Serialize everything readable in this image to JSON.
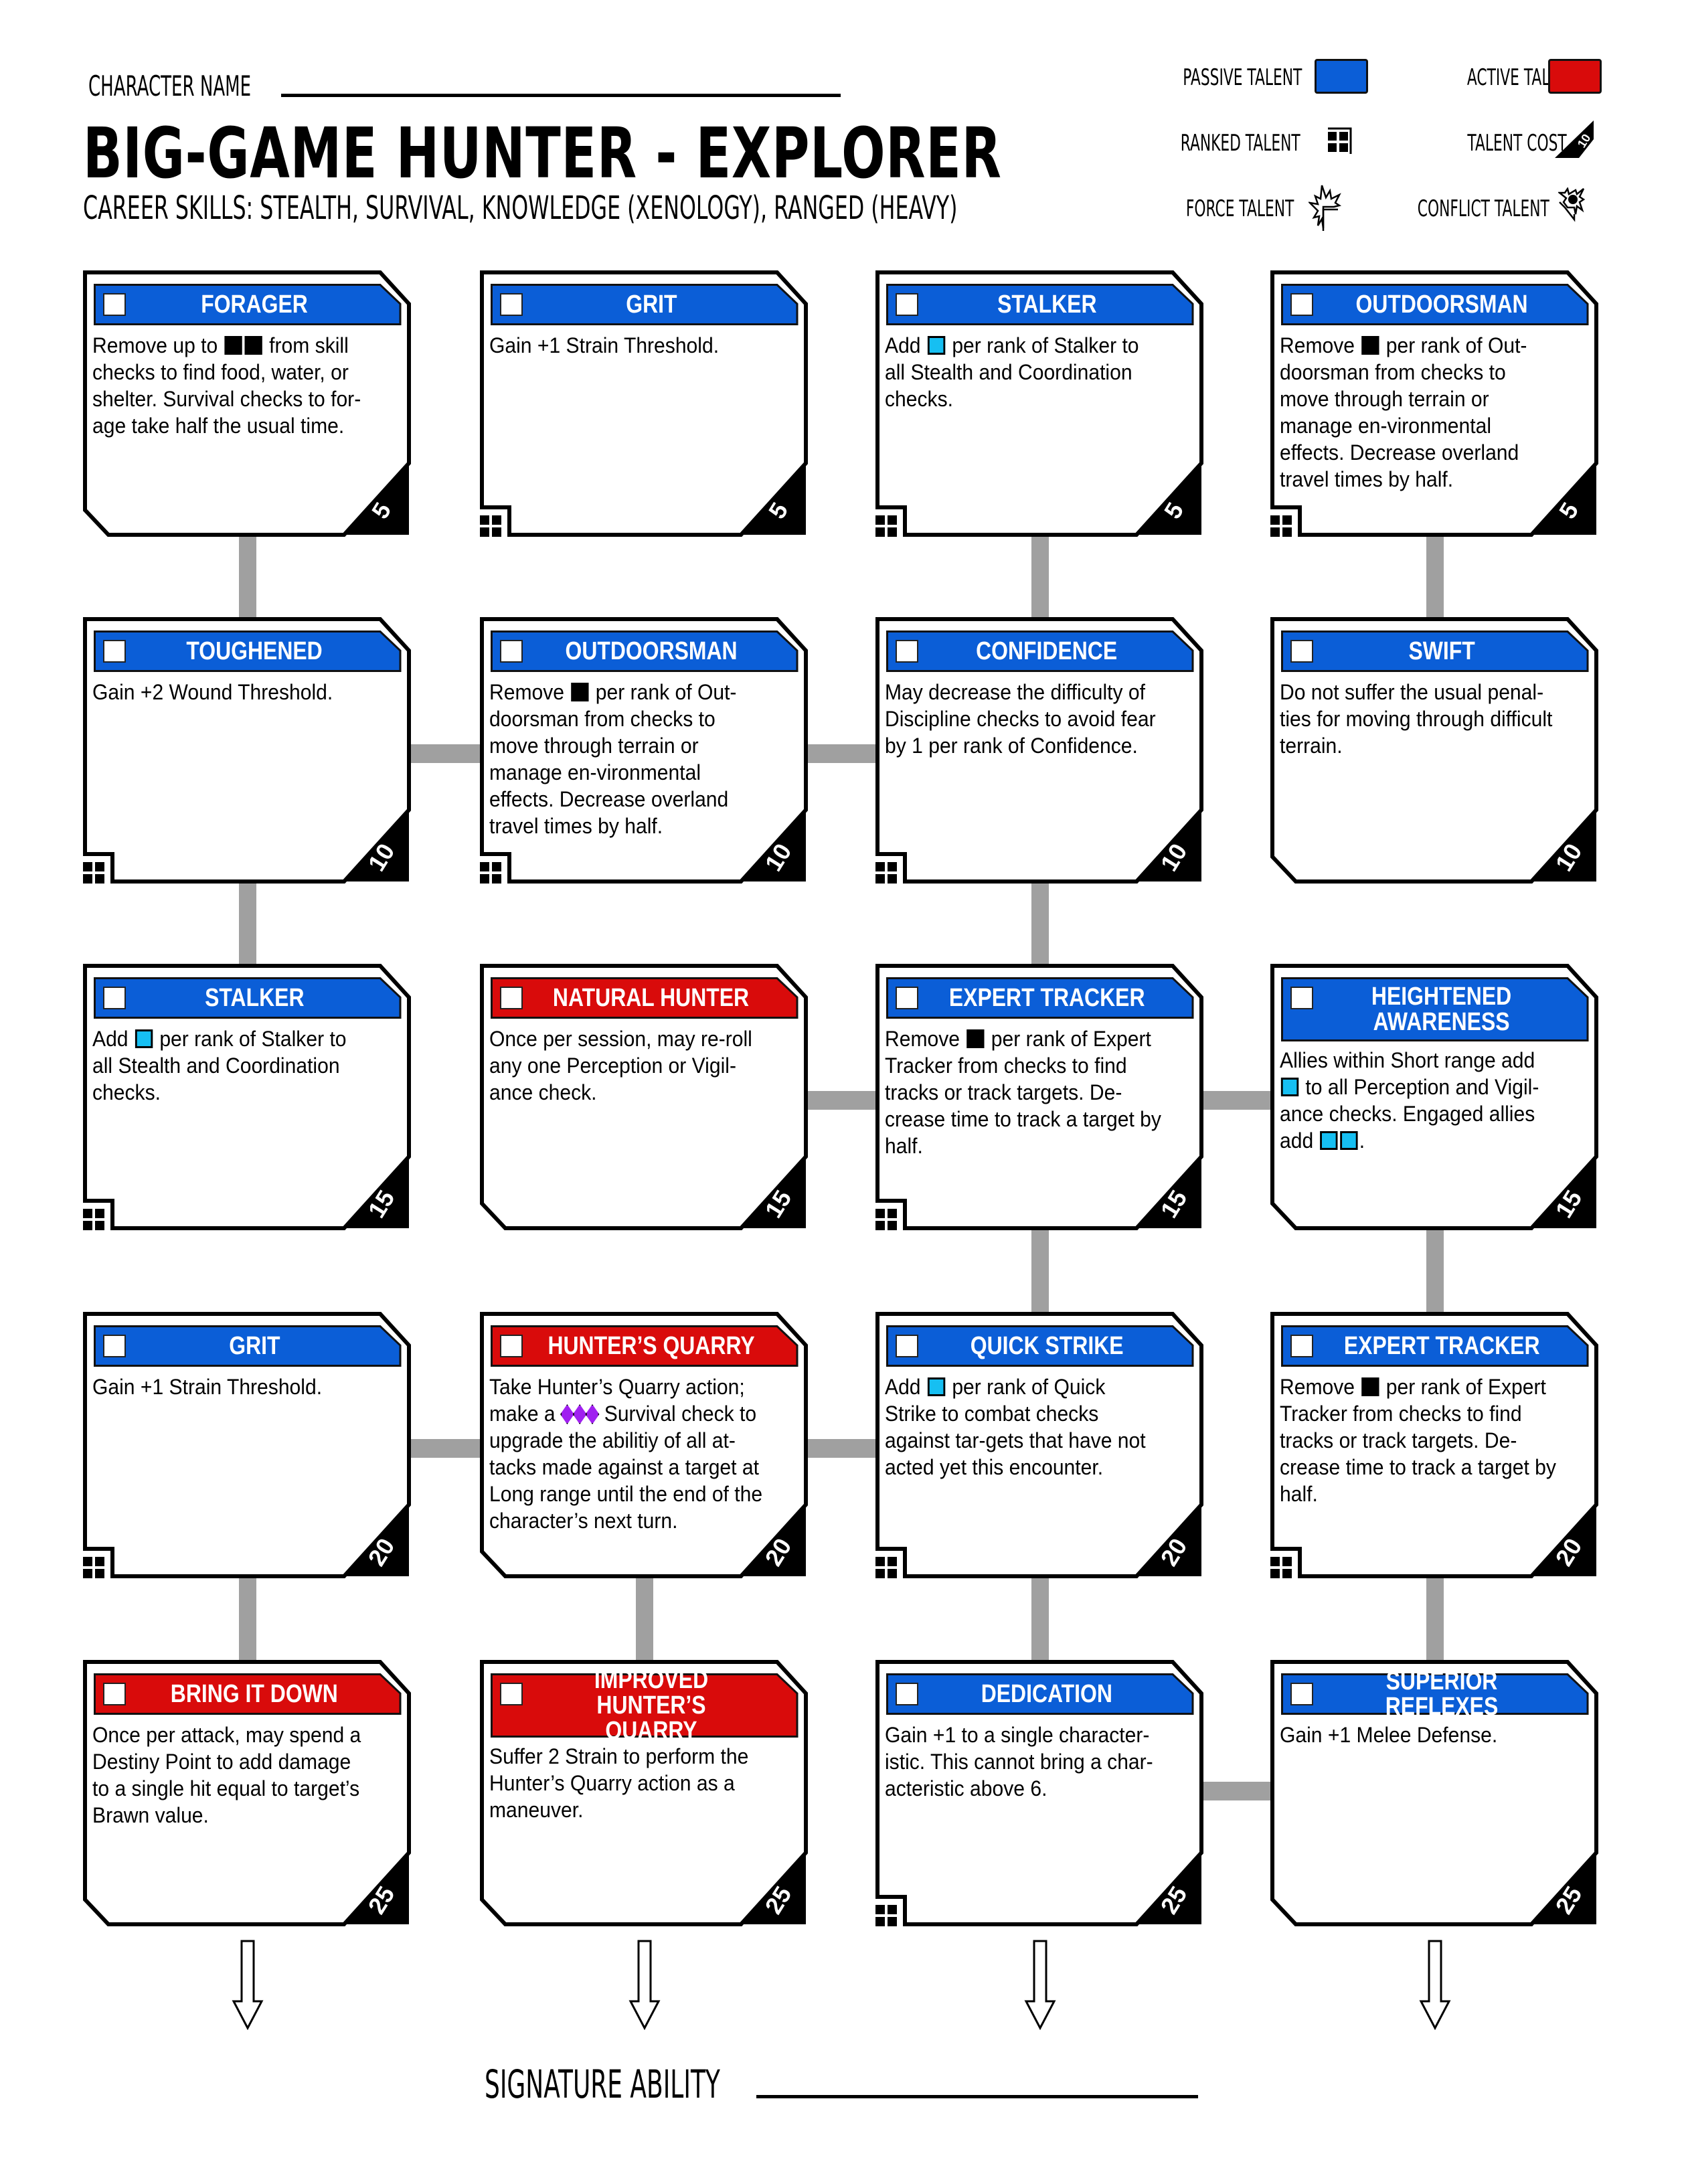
{
  "header": {
    "character_name_label": "CHARACTER NAME",
    "character_name_value": "",
    "title": "BIG-GAME HUNTER  -  EXPLORER",
    "career_skills": "CAREER SKILLS:  STEALTH, SURVIVAL, KNOWLEDGE (XENOLOGY), RANGED (HEAVY)"
  },
  "legend": {
    "passive": {
      "label": "PASSIVE TALENT",
      "color": "#0b5ed7"
    },
    "active": {
      "label": "ACTIVE TALENT",
      "color": "#d90b0b"
    },
    "ranked": {
      "label": "RANKED TALENT",
      "icon": "ranked-talent-icon"
    },
    "cost": {
      "label": "TALENT COST",
      "icon": "talent-cost-icon",
      "example": "10"
    },
    "force": {
      "label": "FORCE TALENT",
      "icon": "force-talent-icon"
    },
    "conflict": {
      "label": "CONFLICT TALENT",
      "icon": "conflict-talent-icon"
    }
  },
  "colors": {
    "passive": "#0b5ed7",
    "active": "#d90b0b",
    "boost_die": "#16bff2",
    "setback_die": "#000000",
    "difficulty_die": "#a020f0",
    "connector": "#a0a0a0"
  },
  "talents": [
    [
      {
        "title": "FORAGER",
        "type": "passive",
        "ranked": false,
        "cost": "5",
        "body": [
          {
            "t": "Remove up to "
          },
          {
            "die": "setback"
          },
          {
            "die": "setback"
          },
          {
            "t": " from skill checks to find food, water, or shelter. Survival checks to for-age take half the usual time."
          }
        ]
      },
      {
        "title": "GRIT",
        "type": "passive",
        "ranked": true,
        "cost": "5",
        "body": [
          {
            "t": "Gain +1 Strain Threshold."
          }
        ]
      },
      {
        "title": "STALKER",
        "type": "passive",
        "ranked": true,
        "cost": "5",
        "body": [
          {
            "t": "Add "
          },
          {
            "die": "boost"
          },
          {
            "t": " per rank of Stalker to all Stealth and Coordination checks."
          }
        ]
      },
      {
        "title": "OUTDOORSMAN",
        "type": "passive",
        "ranked": true,
        "cost": "5",
        "body": [
          {
            "t": "Remove "
          },
          {
            "die": "setback"
          },
          {
            "t": " per rank of Out-doorsman from checks to move through terrain or manage en-vironmental effects. Decrease overland travel times by half."
          }
        ]
      }
    ],
    [
      {
        "title": "TOUGHENED",
        "type": "passive",
        "ranked": true,
        "cost": "10",
        "body": [
          {
            "t": "Gain +2 Wound Threshold."
          }
        ]
      },
      {
        "title": "OUTDOORSMAN",
        "type": "passive",
        "ranked": true,
        "cost": "10",
        "body": [
          {
            "t": "Remove "
          },
          {
            "die": "setback"
          },
          {
            "t": " per rank of Out-doorsman from checks to move through terrain or manage en-vironmental effects. Decrease overland travel times by half."
          }
        ]
      },
      {
        "title": "CONFIDENCE",
        "type": "passive",
        "ranked": true,
        "cost": "10",
        "body": [
          {
            "t": "May decrease the difficulty of Discipline checks to avoid fear by 1 per rank of Confidence."
          }
        ]
      },
      {
        "title": "SWIFT",
        "type": "passive",
        "ranked": false,
        "cost": "10",
        "body": [
          {
            "t": "Do not suffer the usual penal-ties for moving through difficult terrain."
          }
        ]
      }
    ],
    [
      {
        "title": "STALKER",
        "type": "passive",
        "ranked": true,
        "cost": "15",
        "body": [
          {
            "t": "Add "
          },
          {
            "die": "boost"
          },
          {
            "t": " per rank of Stalker to all Stealth and Coordination checks."
          }
        ]
      },
      {
        "title": "NATURAL HUNTER",
        "type": "active",
        "ranked": false,
        "cost": "15",
        "body": [
          {
            "t": "Once per session, may re-roll any one Perception or Vigil-ance check."
          }
        ]
      },
      {
        "title": "EXPERT TRACKER",
        "type": "passive",
        "ranked": true,
        "cost": "15",
        "body": [
          {
            "t": "Remove "
          },
          {
            "die": "setback"
          },
          {
            "t": " per rank of Expert Tracker from checks to find tracks or track targets. De-crease time to track a target by half."
          }
        ]
      },
      {
        "title": "HEIGHTENED\nAWARENESS",
        "type": "passive",
        "ranked": false,
        "cost": "15",
        "body": [
          {
            "t": "Allies within Short range add "
          },
          {
            "die": "boost"
          },
          {
            "t": " to all Perception and Vigil-ance checks. Engaged allies add "
          },
          {
            "die": "boost"
          },
          {
            "die": "boost"
          },
          {
            "t": "."
          }
        ]
      }
    ],
    [
      {
        "title": "GRIT",
        "type": "passive",
        "ranked": true,
        "cost": "20",
        "body": [
          {
            "t": "Gain +1 Strain Threshold."
          }
        ]
      },
      {
        "title": "HUNTER’S QUARRY",
        "type": "active",
        "ranked": false,
        "cost": "20",
        "body": [
          {
            "t": "Take Hunter’s Quarry action; make a "
          },
          {
            "die": "difficulty"
          },
          {
            "die": "difficulty"
          },
          {
            "die": "difficulty"
          },
          {
            "t": " Survival check to upgrade the abilitiy of all at-tacks made against a target at Long range until the end of the character’s next turn."
          }
        ]
      },
      {
        "title": "QUICK STRIKE",
        "type": "passive",
        "ranked": true,
        "cost": "20",
        "body": [
          {
            "t": "Add "
          },
          {
            "die": "boost"
          },
          {
            "t": " per rank of Quick Strike to combat checks against tar-gets that have not acted yet this encounter."
          }
        ]
      },
      {
        "title": "EXPERT TRACKER",
        "type": "passive",
        "ranked": true,
        "cost": "20",
        "body": [
          {
            "t": "Remove "
          },
          {
            "die": "setback"
          },
          {
            "t": " per rank of Expert Tracker from checks to find tracks or track targets. De-crease time to track a target by half."
          }
        ]
      }
    ],
    [
      {
        "title": "BRING IT DOWN",
        "type": "active",
        "ranked": false,
        "cost": "25",
        "body": [
          {
            "t": "Once per attack, may spend a Destiny Point to add damage to a single hit equal to target’s Brawn value."
          }
        ]
      },
      {
        "title": "IMPROVED HUNTER’S\nQUARRY",
        "type": "active",
        "ranked": false,
        "cost": "25",
        "body": [
          {
            "t": "Suffer 2 Strain to perform the Hunter’s Quarry action as a maneuver."
          }
        ]
      },
      {
        "title": "DEDICATION",
        "type": "passive",
        "ranked": true,
        "cost": "25",
        "body": [
          {
            "t": "Gain +1 to a single character-istic. This cannot bring a char-acteristic above 6."
          }
        ]
      },
      {
        "title": "SUPERIOR REFLEXES",
        "type": "passive",
        "ranked": false,
        "cost": "25",
        "body": [
          {
            "t": "Gain +1 Melee Defense."
          }
        ]
      }
    ]
  ],
  "connections": {
    "vertical": [
      {
        "row_gap": 1,
        "columns": [
          1,
          3,
          4
        ]
      },
      {
        "row_gap": 2,
        "columns": [
          1,
          3
        ]
      },
      {
        "row_gap": 3,
        "columns": [
          3,
          4
        ]
      },
      {
        "row_gap": 4,
        "columns": [
          1,
          2,
          3,
          4
        ]
      }
    ],
    "horizontal": [
      {
        "row": 2,
        "between": [
          [
            1,
            2
          ],
          [
            2,
            3
          ]
        ]
      },
      {
        "row": 3,
        "between": [
          [
            3,
            4
          ],
          [
            2,
            3
          ]
        ]
      },
      {
        "row": 4,
        "between": [
          [
            1,
            2
          ],
          [
            2,
            3
          ]
        ]
      },
      {
        "row": 5,
        "between": [
          [
            3,
            4
          ]
        ]
      }
    ]
  },
  "footer": {
    "signature_label": "SIGNATURE ABILITY",
    "signature_value": ""
  }
}
